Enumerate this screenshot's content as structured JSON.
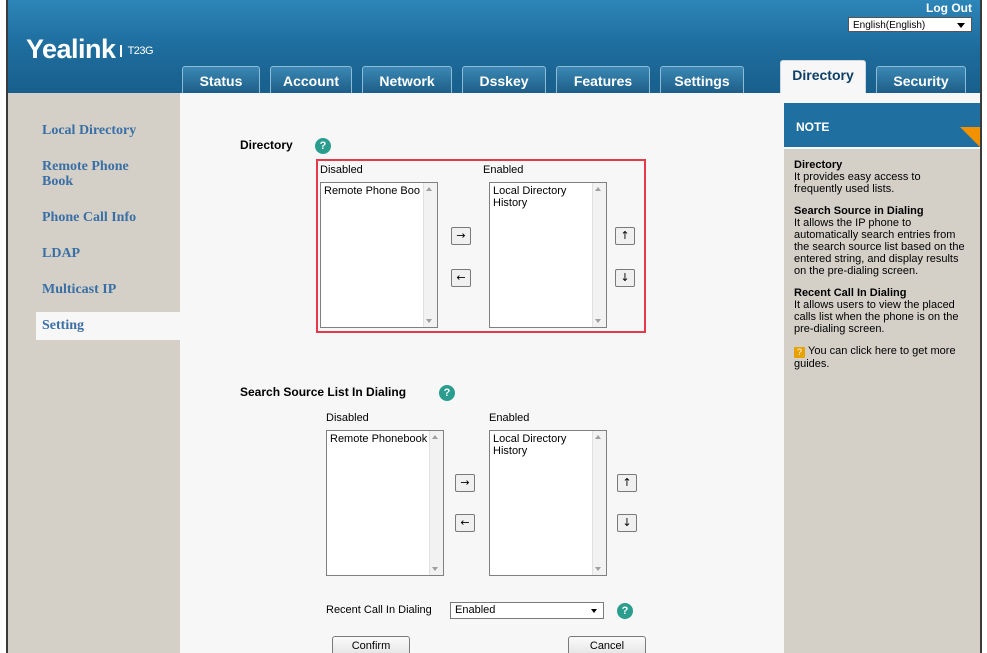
{
  "header": {
    "brand": "Yealink",
    "model": "T23G",
    "logout": "Log Out",
    "language": "English(English)"
  },
  "tabs": [
    {
      "label": "Status"
    },
    {
      "label": "Account"
    },
    {
      "label": "Network"
    },
    {
      "label": "Dsskey"
    },
    {
      "label": "Features"
    },
    {
      "label": "Settings"
    },
    {
      "label": "Directory"
    },
    {
      "label": "Security"
    }
  ],
  "active_tab": "Directory",
  "sidebar": {
    "items": [
      {
        "label": "Local Directory"
      },
      {
        "label": "Remote Phone Book"
      },
      {
        "label": "Phone Call Info"
      },
      {
        "label": "LDAP"
      },
      {
        "label": "Multicast IP"
      },
      {
        "label": "Setting"
      }
    ],
    "active": "Setting"
  },
  "directory": {
    "title": "Directory",
    "disabled_label": "Disabled",
    "enabled_label": "Enabled",
    "disabled_items": [
      "Remote Phone Boo"
    ],
    "enabled_items": [
      "Local Directory",
      "History"
    ]
  },
  "search_source": {
    "title": "Search Source List In Dialing",
    "disabled_label": "Disabled",
    "enabled_label": "Enabled",
    "disabled_items": [
      "Remote Phonebook"
    ],
    "enabled_items": [
      "Local Directory",
      "History"
    ]
  },
  "recent_call": {
    "label": "Recent Call In Dialing",
    "value": "Enabled"
  },
  "buttons": {
    "confirm": "Confirm",
    "cancel": "Cancel"
  },
  "arrows": {
    "right": "→",
    "left": "←",
    "up": "↑",
    "down": "↓"
  },
  "help_glyph": "?",
  "note": {
    "title": "NOTE",
    "sections": [
      {
        "heading": "Directory",
        "text": "It provides easy access to frequently used lists."
      },
      {
        "heading": "Search Source in Dialing",
        "text": "It allows the IP phone to automatically search entries from the search source list based on the entered string, and display results on the pre-dialing screen."
      },
      {
        "heading": "Recent Call In Dialing",
        "text": "It allows users to view the placed calls list when the phone is on the pre-dialing screen."
      }
    ],
    "guide_icon": "?",
    "guide_text": "You can click here to get more guides."
  }
}
